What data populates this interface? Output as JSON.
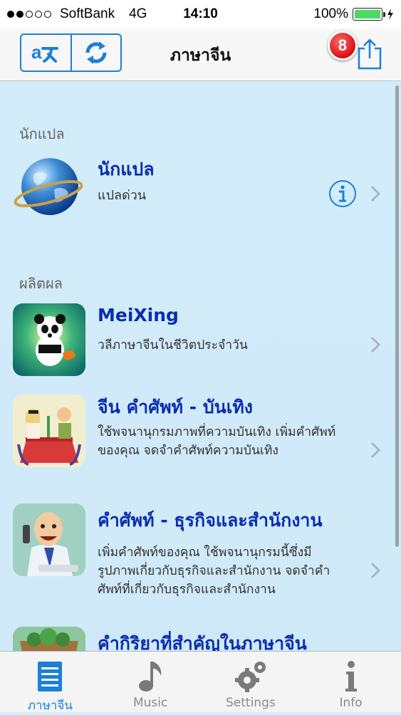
{
  "status_bar": {
    "carrier": "SoftBank",
    "network": "4G",
    "time": "14:10",
    "battery": "100%"
  },
  "nav": {
    "title": "ภาษาจีน",
    "badge_count": "8",
    "translate_icon": "translate-icon",
    "refresh_icon": "refresh-icon",
    "share_icon": "share-icon"
  },
  "sections": [
    {
      "header": "นักแปล"
    },
    {
      "header": "ผลิตผล"
    }
  ],
  "translator": {
    "title": "นักแปล",
    "subtitle": "แปลด่วน"
  },
  "products": [
    {
      "title": "MeiXing",
      "desc": "วลีภาษาจีนในชีวิตประจำวัน"
    },
    {
      "title": "จีน คำศัพท์ - บันเทิง",
      "desc_lines": [
        "ใช้พจนานุกรมภาพที่ความบันเทิง  เพิ่มคำศัพท์",
        "ของคุณ  จดจำคำศัพท์ความบันเทิง"
      ]
    },
    {
      "title": "คำศัพท์ - ธุรกิจและสำนักงาน",
      "desc_lines": [
        "เพิ่มคำศัพท์ของคุณ  ใช้พจนานุกรมนี้ซึ่งมี",
        "รูปภาพเกี่ยวกับธุรกิจและสำนักงาน  จดจำคำ",
        "ศัพท์ที่เกี่ยวกับธุรกิจและสำนักงาน"
      ]
    },
    {
      "title": "คำกิริยาที่สำคัญในภาษาจีน"
    }
  ],
  "tabs": [
    {
      "label": "ภาษาจีน",
      "icon": "list-icon",
      "active": true
    },
    {
      "label": "Music",
      "icon": "music-note-icon"
    },
    {
      "label": "Settings",
      "icon": "gear-icon"
    },
    {
      "label": "Info",
      "icon": "info-icon"
    }
  ],
  "colors": {
    "accent": "#1c7fd8",
    "title_blue": "#0a2db0",
    "badge_red": "#d81010",
    "background": "#d3ecfa"
  }
}
